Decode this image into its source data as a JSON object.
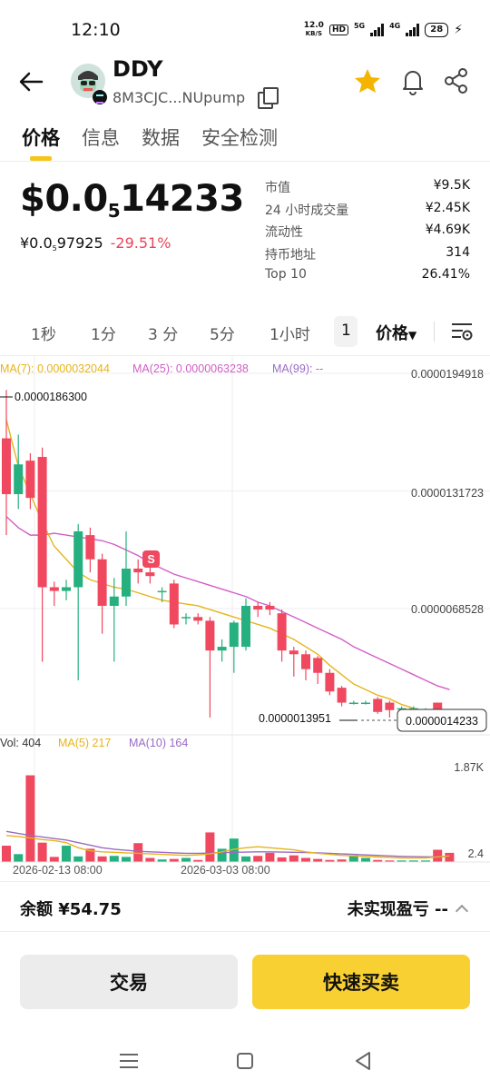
{
  "status_bar": {
    "time": "12:10",
    "net_speed_value": "12.0",
    "net_speed_unit": "KB/S",
    "hd_badge": "HD",
    "network_5g": "5G",
    "network_4g": "4G",
    "battery": "28"
  },
  "header": {
    "token_name": "DDY",
    "address_short": "8M3CJC...NUpump",
    "favorite_color": "#f5b400"
  },
  "tabs": [
    "价格",
    "信息",
    "数据",
    "安全检测"
  ],
  "price": {
    "main_prefix": "$0.0",
    "main_zero_count": "5",
    "main_digits": "14233",
    "cny_prefix": "¥0.0",
    "cny_zero_count": "5",
    "cny_digits": "97925",
    "change": "-29.51%",
    "change_color": "#e8475a"
  },
  "stats": [
    {
      "label": "市值",
      "value": "¥9.5K"
    },
    {
      "label": "24 小时成交量",
      "value": "¥2.45K"
    },
    {
      "label": "流动性",
      "value": "¥4.69K"
    },
    {
      "label": "持币地址",
      "value": "314"
    },
    {
      "label": "Top 10",
      "value": "26.41%"
    }
  ],
  "intervals": [
    "1秒",
    "1分",
    "3 分",
    "5分",
    "1小时",
    "1"
  ],
  "price_dropdown": "价格",
  "chart_data": {
    "type": "candlestick",
    "ma_legend": {
      "ma7": "MA(7): 0.0000032044",
      "ma25": "MA(25): 0.0000063238",
      "ma99": "MA(99): --"
    },
    "y_ticks": [
      "0.0000194918",
      "0.0000131723",
      "0.0000068528"
    ],
    "high_marker": "0.0000186300",
    "low_marker": "0.0000013951",
    "current_price": "0.0000014233",
    "sell_marker": "S",
    "vol_legend": {
      "vol": "Vol: 404",
      "ma5": "MA(5) 217",
      "ma10": "MA(10) 164"
    },
    "vol_ticks": [
      "1.87K",
      "2.4"
    ],
    "x_labels": [
      "2026-02-13 08:00",
      "2026-03-03 08:00"
    ],
    "colors": {
      "up": "#26b07f",
      "down": "#f0485f",
      "ma7": "#e6b419",
      "ma25": "#d05fc7",
      "ma10": "#9a6bc4"
    },
    "candles": [
      {
        "o": 1.6e-05,
        "c": 1.3e-05,
        "h": 1.86e-05,
        "l": 1.08e-05
      },
      {
        "o": 1.3e-05,
        "c": 1.46e-05,
        "h": 1.62e-05,
        "l": 1.22e-05
      },
      {
        "o": 1.48e-05,
        "c": 1.28e-05,
        "h": 1.52e-05,
        "l": 1.22e-05
      },
      {
        "o": 1.5e-05,
        "c": 8e-06,
        "h": 1.55e-05,
        "l": 4e-06
      },
      {
        "o": 8e-06,
        "c": 7.8e-06,
        "h": 8.3e-06,
        "l": 7e-06
      },
      {
        "o": 7.8e-06,
        "c": 8e-06,
        "h": 8.4e-06,
        "l": 7.3e-06
      },
      {
        "o": 8e-06,
        "c": 1.1e-05,
        "h": 1.14e-05,
        "l": 3e-06
      },
      {
        "o": 1.08e-05,
        "c": 9.5e-06,
        "h": 1.12e-05,
        "l": 8.8e-06
      },
      {
        "o": 9.5e-06,
        "c": 7e-06,
        "h": 9.8e-06,
        "l": 5.5e-06
      },
      {
        "o": 7e-06,
        "c": 7.5e-06,
        "h": 8.5e-06,
        "l": 4e-06
      },
      {
        "o": 7.5e-06,
        "c": 9e-06,
        "h": 1.1e-05,
        "l": 7e-06
      },
      {
        "o": 9e-06,
        "c": 8.8e-06,
        "h": 9.5e-06,
        "l": 8.2e-06
      },
      {
        "o": 8.8e-06,
        "c": 8.6e-06,
        "h": 9.3e-06,
        "l": 8.2e-06
      },
      {
        "o": 7.8e-06,
        "c": 7.8e-06,
        "h": 8e-06,
        "l": 7.2e-06
      },
      {
        "o": 8.2e-06,
        "c": 6e-06,
        "h": 8.4e-06,
        "l": 5.8e-06
      },
      {
        "o": 6.4e-06,
        "c": 6.4e-06,
        "h": 6.6e-06,
        "l": 6e-06
      },
      {
        "o": 6.4e-06,
        "c": 6.2e-06,
        "h": 6.6e-06,
        "l": 6e-06
      },
      {
        "o": 6.2e-06,
        "c": 4.6e-06,
        "h": 6.4e-06,
        "l": 1e-06
      },
      {
        "o": 4.6e-06,
        "c": 4.8e-06,
        "h": 5.2e-06,
        "l": 4e-06
      },
      {
        "o": 4.8e-06,
        "c": 6.1e-06,
        "h": 6.2e-06,
        "l": 3.4e-06
      },
      {
        "o": 4.8e-06,
        "c": 7e-06,
        "h": 7.4e-06,
        "l": 4.6e-06
      },
      {
        "o": 7e-06,
        "c": 6.8e-06,
        "h": 7.2e-06,
        "l": 6.4e-06
      },
      {
        "o": 7e-06,
        "c": 6.8e-06,
        "h": 7.2e-06,
        "l": 6.5e-06
      },
      {
        "o": 6.6e-06,
        "c": 4.6e-06,
        "h": 6.8e-06,
        "l": 4e-06
      },
      {
        "o": 4.6e-06,
        "c": 4.4e-06,
        "h": 4.8e-06,
        "l": 3.2e-06
      },
      {
        "o": 4.4e-06,
        "c": 3.6e-06,
        "h": 4.6e-06,
        "l": 3e-06
      },
      {
        "o": 4.2e-06,
        "c": 3.4e-06,
        "h": 4.3e-06,
        "l": 2.8e-06
      },
      {
        "o": 3.4e-06,
        "c": 2.4e-06,
        "h": 3.6e-06,
        "l": 2.2e-06
      },
      {
        "o": 2.6e-06,
        "c": 1.8e-06,
        "h": 2.7e-06,
        "l": 1.6e-06
      },
      {
        "o": 1.8e-06,
        "c": 1.8e-06,
        "h": 1.9e-06,
        "l": 1.7e-06
      },
      {
        "o": 1.8e-06,
        "c": 1.8e-06,
        "h": 1.9e-06,
        "l": 1.7e-06
      },
      {
        "o": 2e-06,
        "c": 1.3e-06,
        "h": 2.1e-06,
        "l": 1.2e-06
      },
      {
        "o": 1.8e-06,
        "c": 1.4e-06,
        "h": 1.9e-06,
        "l": 1e-06
      },
      {
        "o": 1.5e-06,
        "c": 1.5e-06,
        "h": 1.6e-06,
        "l": 1.4e-06
      },
      {
        "o": 1.5e-06,
        "c": 1.5e-06,
        "h": 1.6e-06,
        "l": 1.4e-06
      },
      {
        "o": 1.4e-06,
        "c": 1.4e-06,
        "h": 1.5e-06,
        "l": 1.3e-06
      },
      {
        "o": 1.8e-06,
        "c": 1e-06,
        "h": 1.8e-06,
        "l": 9e-07
      },
      {
        "o": 1e-06,
        "c": 6e-07,
        "h": 1.1e-06,
        "l": 5e-07
      }
    ],
    "ma7_values": [
      1.7e-05,
      1.45e-05,
      1.3e-05,
      1.15e-05,
      1.02e-05,
      9.5e-06,
      8.8e-06,
      8.4e-06,
      8.2e-06,
      8e-06,
      7.9e-06,
      7.7e-06,
      7.5e-06,
      7.3e-06,
      7.2e-06,
      7.1e-06,
      7e-06,
      6.8e-06,
      6.6e-06,
      6.4e-06,
      6.2e-06,
      6e-06,
      5.8e-06,
      5.5e-06,
      5.2e-06,
      4.8e-06,
      4.4e-06,
      3.8e-06,
      3.3e-06,
      2.8e-06,
      2.5e-06,
      2.2e-06,
      2e-06,
      1.7e-06,
      1.5e-06,
      1.3e-06,
      1.1e-06,
      9e-07
    ],
    "ma25_values": [
      1.18e-05,
      1.12e-05,
      1.08e-05,
      1.08e-05,
      1.09e-05,
      1.08e-05,
      1.07e-05,
      1.06e-05,
      1.05e-05,
      1.03e-05,
      1e-05,
      9.7e-06,
      9.3e-06,
      9e-06,
      8.7e-06,
      8.5e-06,
      8.3e-06,
      8.1e-06,
      7.9e-06,
      7.7e-06,
      7.5e-06,
      7.2e-06,
      7e-06,
      6.7e-06,
      6.4e-06,
      6.1e-06,
      5.8e-06,
      5.5e-06,
      5.2e-06,
      4.8e-06,
      4.5e-06,
      4.2e-06,
      3.9e-06,
      3.6e-06,
      3.3e-06,
      3e-06,
      2.7e-06,
      2.5e-06
    ],
    "volumes": [
      320,
      155,
      1700,
      380,
      100,
      320,
      110,
      260,
      110,
      120,
      100,
      370,
      80,
      50,
      60,
      80,
      40,
      580,
      260,
      460,
      110,
      120,
      180,
      90,
      130,
      80,
      60,
      40,
      50,
      130,
      80,
      40,
      30,
      30,
      30,
      30,
      240,
      180
    ],
    "vol_ma5": [
      520,
      500,
      470,
      440,
      420,
      380,
      280,
      220,
      200,
      190,
      180,
      170,
      160,
      150,
      140,
      130,
      140,
      160,
      200,
      250,
      280,
      300,
      280,
      260,
      240,
      200,
      170,
      150,
      130,
      120,
      110,
      100,
      90,
      80,
      80,
      80,
      100,
      120
    ],
    "vol_ma10": [
      600,
      560,
      520,
      490,
      460,
      430,
      380,
      330,
      280,
      250,
      230,
      210,
      200,
      190,
      180,
      170,
      170,
      175,
      185,
      190,
      195,
      200,
      200,
      195,
      190,
      185,
      180,
      170,
      160,
      150,
      140,
      130,
      120,
      110,
      105,
      100,
      100,
      110
    ]
  },
  "bottom": {
    "balance": "余额 ¥54.75",
    "pnl": "未实现盈亏 --"
  },
  "buttons": {
    "trade": "交易",
    "quick_trade": "快速买卖"
  }
}
